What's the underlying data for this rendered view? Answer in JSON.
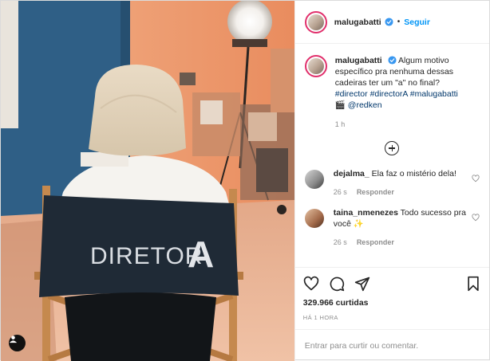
{
  "post": {
    "username": "malugabatti",
    "separator": "•",
    "follow_label": "Seguir",
    "caption": {
      "username": "malugabatti",
      "text": "Algum motivo específico pra nenhuma dessas cadeiras ter um \"a\" no final?",
      "hashtags": "#director #directorA #malugabatti",
      "mention_prefix": "🎬",
      "mention": "@redken",
      "time": "1 h"
    },
    "comments": [
      {
        "username": "dejalma_",
        "text": "Ela faz o mistério dela!",
        "time": "26 s",
        "reply_label": "Responder"
      },
      {
        "username": "taina_nmenezes",
        "text": "Todo sucesso pra você ✨",
        "time": "26 s",
        "reply_label": "Responder"
      }
    ],
    "likes": "329.966 curtidas",
    "posted_ago": "HÁ 1 HORA",
    "add_comment_placeholder": "Entrar para curtir ou comentar."
  },
  "photo": {
    "chair_text_main": "DIRETOR",
    "chair_text_accent": "A"
  },
  "icons": {
    "verified": "verified-badge-icon",
    "like": "heart-icon",
    "comment": "comment-bubble-icon",
    "share": "paper-plane-icon",
    "save": "bookmark-icon",
    "load_more": "plus-circle-icon",
    "tag": "user-tag-icon"
  },
  "colors": {
    "link_blue": "#0095f6",
    "hashtag": "#00376b",
    "muted": "#8e8e8e",
    "verified": "#3897f0"
  }
}
